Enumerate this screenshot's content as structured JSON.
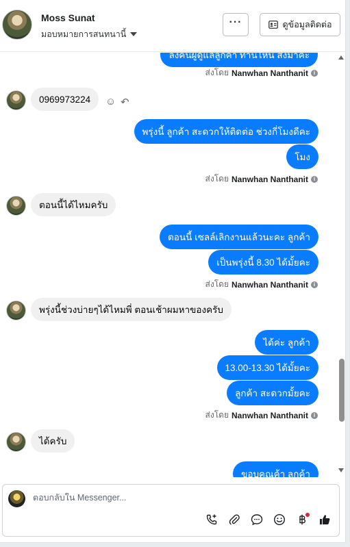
{
  "header": {
    "name": "Moss Sunat",
    "assign_label": "มอบหมายการสนทนานี้",
    "more_label": "···",
    "contact_label": "ดูข้อมูลติดต่อ"
  },
  "messages": [
    {
      "text": "ลิงค์นี้ผู้ดูแลลูกค้า ท่านไหน ส่งมาค่ะ"
    },
    {
      "text": "0969973224"
    },
    {
      "text": "พรุ่งนี้ ลูกค้า สะดวกให้ติดต่อ ช่วงกี่โมงดีคะ"
    },
    {
      "text": "โมง"
    },
    {
      "text": "ตอนนี้ได้ไหมครับ"
    },
    {
      "text": "ตอนนี้ เซลล์เลิกงานแล้วนะคะ  ลูกค้า"
    },
    {
      "text": "เป็นพรุ่งนี้  8.30 ได้มั้ยคะ"
    },
    {
      "text": "พรุ่งนี้ช่วงบ่ายๆได้ไหมพี่ ตอนเช้าผมหาของครับ"
    },
    {
      "text": "ได้ค่ะ  ลูกค้า"
    },
    {
      "text": "13.00-13.30 ได้มั้ยคะ"
    },
    {
      "text": "ลูกค้า สะดวกมั้ยคะ"
    },
    {
      "text": "ได้ครับ"
    },
    {
      "text": "ขอบคุณค้า  ลูกค้า"
    }
  ],
  "sent_by": {
    "prefix": "ส่งโดย",
    "agent": "Nanwhan Nanthanit"
  },
  "composer": {
    "placeholder": "ตอบกลับใน Messenger..."
  },
  "colors": {
    "outgoing_bubble": "#0a7cff",
    "incoming_bubble": "#f0f0f0",
    "like_icon": "#1c1e21",
    "notification_dot": "#e41e3f"
  }
}
